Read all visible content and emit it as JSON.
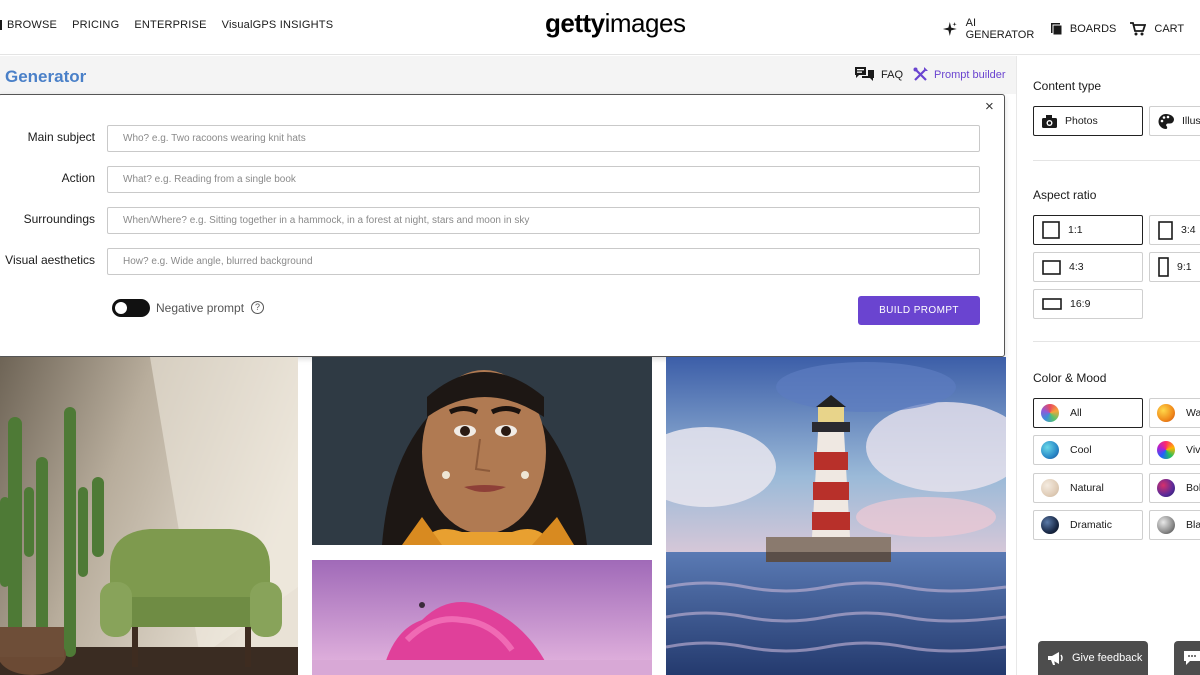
{
  "nav": {
    "left_links": [
      "BROWSE",
      "PRICING",
      "ENTERPRISE",
      "VisualGPS INSIGHTS"
    ],
    "logo_bold": "getty",
    "logo_light": "images",
    "right_links": [
      {
        "label": "AI GENERATOR",
        "icon": "sparkle-icon"
      },
      {
        "label": "BOARDS",
        "icon": "boards-icon"
      },
      {
        "label": "CART",
        "icon": "cart-icon"
      }
    ]
  },
  "generator": {
    "title": "Generator",
    "faq_label": "FAQ",
    "prompt_builder_label": "Prompt builder",
    "close_symbol": "×",
    "fields": [
      {
        "label": "Main subject",
        "placeholder": "Who? e.g. Two racoons wearing knit hats"
      },
      {
        "label": "Action",
        "placeholder": "What? e.g. Reading from a single book"
      },
      {
        "label": "Surroundings",
        "placeholder": "When/Where? e.g. Sitting together in a hammock, in a forest at night, stars and moon in sky"
      },
      {
        "label": "Visual aesthetics",
        "placeholder": "How? e.g. Wide angle, blurred background"
      }
    ],
    "negative_prompt_label": "Negative prompt",
    "negative_prompt_enabled": false,
    "help_symbol": "?",
    "build_button": "BUILD PROMPT"
  },
  "gallery": [
    {
      "subject": "cactus-and-green-armchair"
    },
    {
      "subject": "portrait-woman"
    },
    {
      "subject": "lighthouse-painting"
    },
    {
      "subject": "pink-snow-house"
    }
  ],
  "sidebar": {
    "content_type": {
      "heading": "Content type",
      "options": [
        {
          "label": "Photos",
          "icon": "camera-icon",
          "selected": true
        },
        {
          "label": "Illus",
          "icon": "palette-icon",
          "selected": false
        }
      ]
    },
    "aspect_ratio": {
      "heading": "Aspect ratio",
      "options": [
        {
          "label": "1:1",
          "selected": true
        },
        {
          "label": "3:4",
          "selected": false
        },
        {
          "label": "4:3",
          "selected": false
        },
        {
          "label": "9:1",
          "selected": false
        },
        {
          "label": "16:9",
          "selected": false
        }
      ]
    },
    "color_mood": {
      "heading": "Color & Mood",
      "options": [
        {
          "label": "All",
          "selected": true
        },
        {
          "label": "War",
          "selected": false
        },
        {
          "label": "Cool",
          "selected": false
        },
        {
          "label": "Vivi",
          "selected": false
        },
        {
          "label": "Natural",
          "selected": false
        },
        {
          "label": "Bold",
          "selected": false
        },
        {
          "label": "Dramatic",
          "selected": false
        },
        {
          "label": "Blac",
          "selected": false
        }
      ]
    }
  },
  "feedback": {
    "label": "Give feedback"
  }
}
